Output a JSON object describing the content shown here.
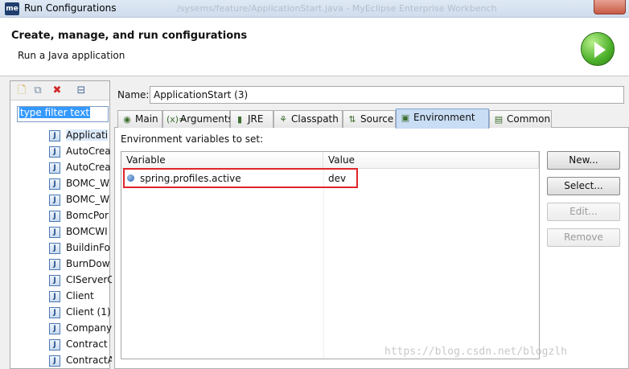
{
  "window": {
    "title": "Run Configurations",
    "app_badge": "me",
    "background_title": "/sysems/feature/ApplicationStart.java - MyEclipse Enterprise Workbench"
  },
  "header": {
    "title": "Create, manage, and run configurations",
    "subtitle": "Run a Java application",
    "icon": "run-play-icon"
  },
  "left_panel": {
    "toolbar_icons": [
      "new-config-icon",
      "duplicate-icon",
      "delete-icon",
      "collapse-all-icon"
    ],
    "filter": {
      "value": "type filter text"
    },
    "items": [
      {
        "label": "Applicati",
        "selected": true
      },
      {
        "label": "AutoCrea"
      },
      {
        "label": "AutoCrea"
      },
      {
        "label": "BOMC_W"
      },
      {
        "label": "BOMC_W"
      },
      {
        "label": "BomcPor"
      },
      {
        "label": "BOMCWI"
      },
      {
        "label": "BuildinFo"
      },
      {
        "label": "BurnDow"
      },
      {
        "label": "CIServerC"
      },
      {
        "label": "Client"
      },
      {
        "label": "Client (1)"
      },
      {
        "label": "Company"
      },
      {
        "label": "Contract"
      },
      {
        "label": "ContractA"
      }
    ],
    "item_icon": "java-file-icon",
    "item_icon_glyph": "J"
  },
  "config": {
    "name_label": "Name:",
    "name_value": "ApplicationStart (3)",
    "tabs": [
      {
        "label": "Main",
        "icon": "main-tab-icon",
        "glyph": "◉"
      },
      {
        "label": "Arguments",
        "icon": "arguments-icon",
        "glyph": "(x)="
      },
      {
        "label": "JRE",
        "icon": "jre-icon",
        "glyph": "▮"
      },
      {
        "label": "Classpath",
        "icon": "classpath-icon",
        "glyph": "⚘"
      },
      {
        "label": "Source",
        "icon": "source-icon",
        "glyph": "⇅"
      },
      {
        "label": "Environment",
        "icon": "environment-icon",
        "glyph": "▣",
        "active": true
      },
      {
        "label": "Common",
        "icon": "common-icon",
        "glyph": "▤"
      }
    ],
    "environment": {
      "label": "Environment variables to set:",
      "columns": [
        "Variable",
        "Value"
      ],
      "rows": [
        {
          "variable": "spring.profiles.active",
          "value": "dev"
        }
      ],
      "buttons": {
        "new": "New...",
        "select": "Select...",
        "edit": "Edit...",
        "remove": "Remove"
      }
    }
  },
  "watermark": "https://blog.csdn.net/blogzlh",
  "colors": {
    "highlight_border": "#e0252a",
    "active_tab": "#c9ddf4",
    "selection": "#3399ff"
  }
}
